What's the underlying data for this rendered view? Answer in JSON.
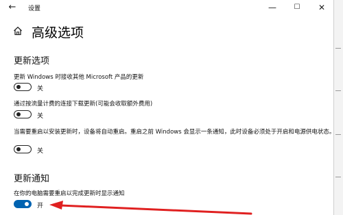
{
  "window": {
    "title": "设置",
    "back_icon": "←",
    "minimize_icon": "—",
    "maximize_icon": "☐",
    "close_icon": "✕"
  },
  "page": {
    "title": "高级选项"
  },
  "update_options": {
    "heading": "更新选项",
    "items": [
      {
        "label": "更新 Windows 时接收其他 Microsoft 产品的更新",
        "state": "关",
        "on": false
      },
      {
        "label": "通过按流量计费的连接下载更新(可能会收取额外费用)",
        "state": "关",
        "on": false
      },
      {
        "label": "当需要重启以安装更新时，设备将自动重启。重启之前 Windows 会显示一条通知，此时设备必须处于开启和电源供电状态。",
        "state": "关",
        "on": false
      }
    ]
  },
  "update_notifications": {
    "heading": "更新通知",
    "items": [
      {
        "label": "在你的电脑需要重启以完成更新时显示通知",
        "state": "开",
        "on": true
      }
    ]
  },
  "colors": {
    "toggle_on": "#0063b1",
    "annotation_arrow": "#e02020"
  }
}
